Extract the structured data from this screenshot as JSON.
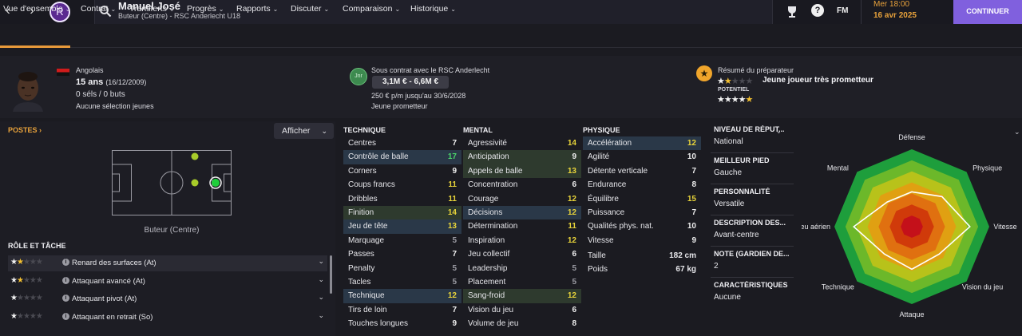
{
  "topbar": {
    "back": "‹",
    "forward": "›",
    "club_crest": "R",
    "player_name": "Manuel José",
    "player_sub": "Buteur (Centre) - RSC Anderlecht U18",
    "help": "?",
    "fm": "FM",
    "time": "Mer 18:00",
    "date": "16 avr 2025",
    "continue": "CONTINUER"
  },
  "nav": {
    "tabs": [
      "Vue d'ensemble",
      "Contrat",
      "Transferts",
      "Progrès",
      "Rapports",
      "Discuter",
      "Comparaison",
      "Historique"
    ],
    "chev": "⌄"
  },
  "profile": {
    "nationality": "Angolais",
    "age": "15 ans",
    "dob": "(16/12/2009)",
    "caps": "0 séls / 0 buts",
    "youth": "Aucune sélection jeunes"
  },
  "contract": {
    "icon_text": "Jnr",
    "title": "Sous contrat avec le RSC Anderlecht",
    "value": "3,1M € - 6,6M €",
    "wage": "250 € p/m jusqu'au 30/6/2028",
    "status": "Jeune prometteur"
  },
  "scout": {
    "icon": "★",
    "title": "Résumé du préparateur",
    "verdict": "Jeune joueur très prometteur",
    "potential_label": "POTENTIEL",
    "current_stars": 1.5,
    "potential_stars": 4.5
  },
  "positions": {
    "title": "POSTES ›",
    "show_button": "Afficher",
    "position_label": "Buteur (Centre)"
  },
  "roles": {
    "title": "RÔLE ET TÂCHE",
    "items": [
      {
        "label": "Renard des surfaces (At)",
        "stars": 1.5
      },
      {
        "label": "Attaquant avancé (At)",
        "stars": 1.5
      },
      {
        "label": "Attaquant pivot (At)",
        "stars": 1
      },
      {
        "label": "Attaquant en retrait (So)",
        "stars": 1
      }
    ]
  },
  "attributes": {
    "technique_title": "TECHNIQUE",
    "mental_title": "MENTAL",
    "physique_title": "PHYSIQUE",
    "technique": [
      [
        "Centres",
        "7"
      ],
      [
        "Contrôle de balle",
        "17"
      ],
      [
        "Corners",
        "9"
      ],
      [
        "Coups francs",
        "11"
      ],
      [
        "Dribbles",
        "11"
      ],
      [
        "Finition",
        "14"
      ],
      [
        "Jeu de tête",
        "13"
      ],
      [
        "Marquage",
        "5"
      ],
      [
        "Passes",
        "7"
      ],
      [
        "Penalty",
        "5"
      ],
      [
        "Tacles",
        "5"
      ],
      [
        "Technique",
        "12"
      ],
      [
        "Tirs de loin",
        "7"
      ],
      [
        "Touches longues",
        "9"
      ]
    ],
    "mental": [
      [
        "Agressivité",
        "14"
      ],
      [
        "Anticipation",
        "9"
      ],
      [
        "Appels de balle",
        "13"
      ],
      [
        "Concentration",
        "6"
      ],
      [
        "Courage",
        "12"
      ],
      [
        "Décisions",
        "12"
      ],
      [
        "Détermination",
        "11"
      ],
      [
        "Inspiration",
        "12"
      ],
      [
        "Jeu collectif",
        "6"
      ],
      [
        "Leadership",
        "5"
      ],
      [
        "Placement",
        "5"
      ],
      [
        "Sang-froid",
        "12"
      ],
      [
        "Vision du jeu",
        "6"
      ],
      [
        "Volume de jeu",
        "8"
      ]
    ],
    "physique": [
      [
        "Accélération",
        "12"
      ],
      [
        "Agilité",
        "10"
      ],
      [
        "Détente verticale",
        "7"
      ],
      [
        "Endurance",
        "8"
      ],
      [
        "Équilibre",
        "15"
      ],
      [
        "Puissance",
        "7"
      ],
      [
        "Qualités phys. nat.",
        "10"
      ],
      [
        "Vitesse",
        "9"
      ]
    ],
    "height_label": "Taille",
    "height": "182 cm",
    "weight_label": "Poids",
    "weight": "67 kg"
  },
  "info": {
    "items": [
      {
        "title": "NIVEAU DE RÉPUT...",
        "value": "National"
      },
      {
        "title": "MEILLEUR PIED",
        "value": "Gauche"
      },
      {
        "title": "PERSONNALITÉ",
        "value": "Versatile"
      },
      {
        "title": "DESCRIPTION DES...",
        "value": "Avant-centre"
      },
      {
        "title": "NOTE (GARDIEN DE...",
        "value": "2"
      },
      {
        "title": "CARACTÉRISTIQUES ...",
        "value": "Aucune"
      }
    ]
  },
  "radar": {
    "labels": [
      "Défense",
      "Physique",
      "Vitesse",
      "Vision du jeu",
      "Attaque",
      "Technique",
      "Jeu aérien",
      "Mental"
    ],
    "values": [
      0.45,
      0.55,
      0.75,
      0.5,
      0.55,
      0.5,
      0.75,
      0.45
    ],
    "colors": [
      "#1e9e3c",
      "#6cb82a",
      "#b8c21a",
      "#e0a012",
      "#e07010",
      "#d03a0a",
      "#c4101a"
    ]
  }
}
